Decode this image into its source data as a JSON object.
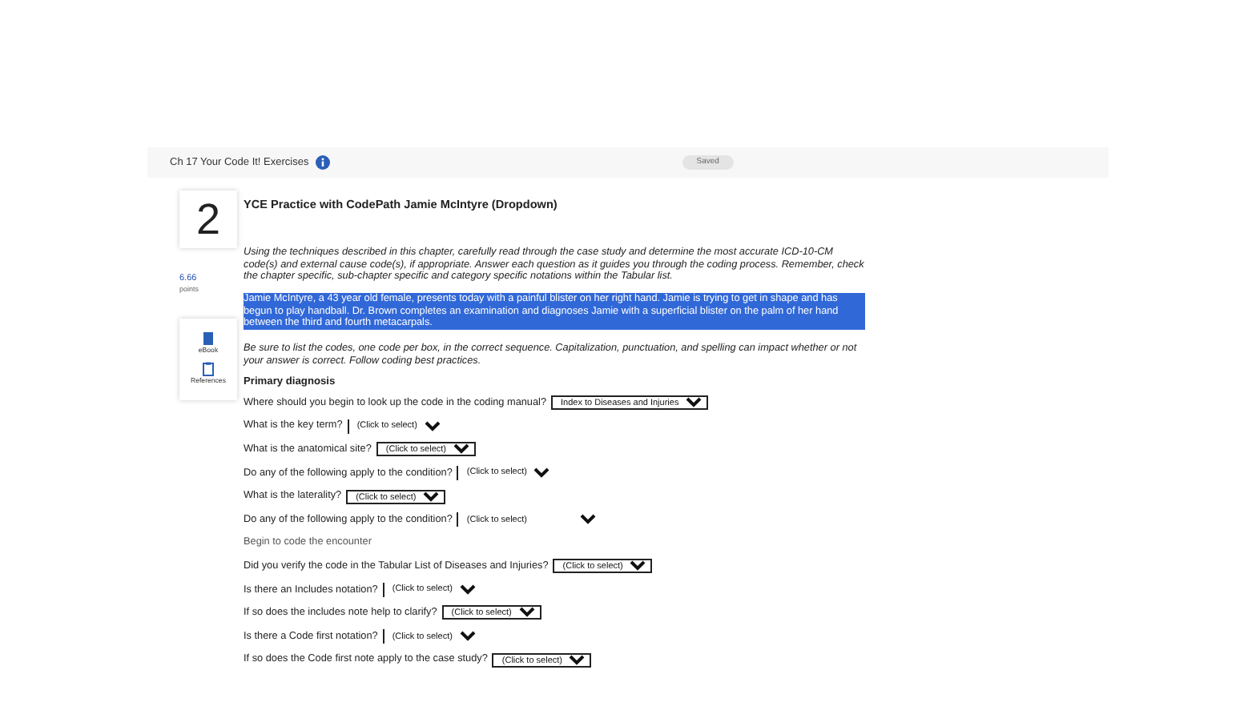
{
  "header": {
    "title": "Ch 17 Your Code It! Exercises",
    "button": "Saved"
  },
  "question": {
    "number": "2",
    "points": "6.66",
    "points_label": "points",
    "tools": [
      {
        "kind": "ebook",
        "label": "eBook"
      },
      {
        "kind": "references",
        "label": "References"
      }
    ]
  },
  "title": "YCE Practice with CodePath Jamie McIntyre (Dropdown)",
  "instructions": "Using the techniques described in this chapter, carefully read through the case study and determine the most accurate ICD-10-CM code(s) and external cause code(s), if appropriate. Answer each question as it guides you through the coding process. Remember, check the chapter specific, sub-chapter specific and category specific notations within the Tabular list.",
  "case_study": {
    "text": "Jamie McIntyre, a 43 year old female, presents today with a painful blister on her right hand. Jamie is trying to get in shape and has begun to play handball. Dr. Brown completes an examination and diagnoses Jamie with a superficial blister on the palm of her hand between the third and fourth metacarpals.",
    "selected": true
  },
  "note": "Be sure to list the codes, one code per box, in the correct sequence. Capitalization, punctuation, and spelling can impact whether or not your answer is correct. Follow coding best practices.",
  "section": "Primary diagnosis",
  "items": [
    {
      "kind": "boxed",
      "text": "Where should you begin to look up the code in the coding manual?",
      "value": "Index to Diseases and Injuries"
    },
    {
      "kind": "plain",
      "text": "What is the key term?",
      "value": "(Click to select)"
    },
    {
      "kind": "boxed",
      "text": "What is the anatomical site?",
      "value": "(Click to select)"
    },
    {
      "kind": "plain",
      "text": "Do any of the following apply to the condition?",
      "value": "(Click to select)"
    },
    {
      "kind": "boxed",
      "text": "What is the laterality?",
      "value": "(Click to select)"
    },
    {
      "kind": "wide",
      "text": "Do any of the following apply to the condition?",
      "value": "(Click to select)"
    },
    {
      "kind": "heading",
      "text": "Begin to code the encounter"
    },
    {
      "kind": "boxed",
      "text": "Did you verify the code in the Tabular List of Diseases and Injuries?",
      "value": "(Click to select)"
    },
    {
      "kind": "plain",
      "text": "Is there an Includes notation?",
      "value": "(Click to select)"
    },
    {
      "kind": "boxed",
      "text": "If so does the includes note help to clarify?",
      "value": "(Click to select)"
    },
    {
      "kind": "plain",
      "text": "Is there a Code first notation?",
      "value": "(Click to select)"
    },
    {
      "kind": "boxed",
      "text": "If so does the Code first note apply to the case study?",
      "value": "(Click to select)"
    }
  ]
}
